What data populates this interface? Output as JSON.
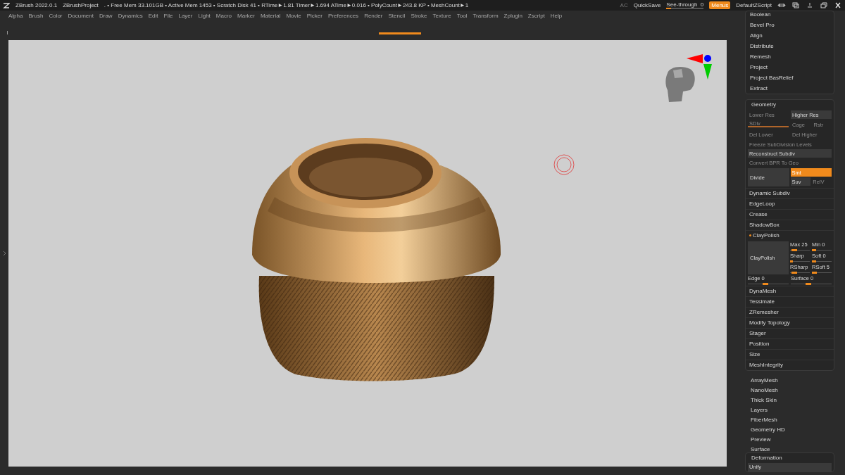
{
  "title_bar": {
    "app": "ZBrush 2022.0.1",
    "project": "ZBrushProject",
    "stats": ". • Free Mem 33.101GB • Active Mem 1453 • Scratch Disk 41 •  RTime►1.81 Timer►1.694 ATime►0.016 • PolyCount►243.8 KP • MeshCount►1",
    "ac": "AC",
    "quicksave": "QuickSave",
    "see_through": {
      "label": "See-through",
      "value": "0",
      "level": 0.12
    },
    "menus": {
      "label": "Menus",
      "on": true
    },
    "script": "DefaultZScript"
  },
  "menu_bar": [
    "Alpha",
    "Brush",
    "Color",
    "Document",
    "Draw",
    "Dynamics",
    "Edit",
    "File",
    "Layer",
    "Light",
    "Macro",
    "Marker",
    "Material",
    "Movie",
    "Picker",
    "Preferences",
    "Render",
    "Stencil",
    "Stroke",
    "Texture",
    "Tool",
    "Transform",
    "Zplugin",
    "Zscript",
    "Help"
  ],
  "tool_panel": {
    "items": [
      "Boolean",
      "Bevel Pro",
      "Align",
      "Distribute",
      "Remesh",
      "Project",
      "Project BasRelief",
      "Extract"
    ]
  },
  "geometry": {
    "title": "Geometry",
    "res_buttons": [
      {
        "label": "Lower Res",
        "disabled": true
      },
      {
        "label": "Higher Res",
        "disabled": false
      }
    ],
    "sdiv": {
      "label": "SDiv",
      "disabled": true,
      "level": 1
    },
    "cage_buttons": [
      {
        "label": "Cage",
        "disabled": true
      },
      {
        "label": "Rstr",
        "disabled": true
      }
    ],
    "del_buttons": [
      {
        "label": "Del Lower",
        "disabled": true
      },
      {
        "label": "Del Higher",
        "disabled": true
      }
    ],
    "wide_buttons": [
      {
        "label": "Freeze SubDivision Levels",
        "disabled": true
      },
      {
        "label": "Reconstruct Subdiv",
        "disabled": false
      },
      {
        "label": "Convert BPR To Geo",
        "disabled": true
      }
    ],
    "divide": {
      "label": "Divide",
      "options": [
        {
          "label": "Smt",
          "selected": true,
          "disabled": false
        },
        {
          "label": "Suv",
          "selected": false,
          "disabled": false
        },
        {
          "label": "RelV",
          "selected": false,
          "disabled": true
        }
      ]
    },
    "subpalettes": [
      {
        "label": "Dynamic Subdiv",
        "expanded": false
      },
      {
        "label": "EdgeLoop",
        "expanded": false
      },
      {
        "label": "Crease",
        "expanded": false
      },
      {
        "label": "ShadowBox",
        "expanded": false
      },
      {
        "label": "ClayPolish",
        "expanded": true,
        "button": "ClayPolish",
        "sliders": [
          {
            "label": "Max",
            "value": "25",
            "level": 0.35
          },
          {
            "label": "Min",
            "value": "0",
            "level": 0.2
          },
          {
            "label": "Sharp",
            "level": 0.15
          },
          {
            "label": "Soft",
            "value": "0",
            "level": 0.2
          },
          {
            "label": "RSharp",
            "level": 0.35
          },
          {
            "label": "RSoft",
            "value": "5",
            "level": 0.25
          }
        ],
        "wide_sliders": [
          {
            "label": "Edge",
            "value": "0",
            "level": 0.5
          },
          {
            "label": "Surface",
            "value": "0",
            "level": 0.5
          }
        ]
      },
      {
        "label": "DynaMesh",
        "expanded": false
      },
      {
        "label": "Tessimate",
        "expanded": false
      },
      {
        "label": "ZRemesher",
        "expanded": false
      },
      {
        "label": "Modify Topology",
        "expanded": false
      },
      {
        "label": "Stager",
        "expanded": false
      },
      {
        "label": "Position",
        "expanded": false
      },
      {
        "label": "Size",
        "expanded": false
      },
      {
        "label": "MeshIntegrity",
        "expanded": false
      }
    ]
  },
  "more_palettes": [
    "ArrayMesh",
    "NanoMesh",
    "Thick Skin",
    "Layers",
    "FiberMesh",
    "Geometry HD",
    "Preview",
    "Surface"
  ],
  "deformation": {
    "title": "Deformation",
    "items": [
      "Unify"
    ]
  }
}
